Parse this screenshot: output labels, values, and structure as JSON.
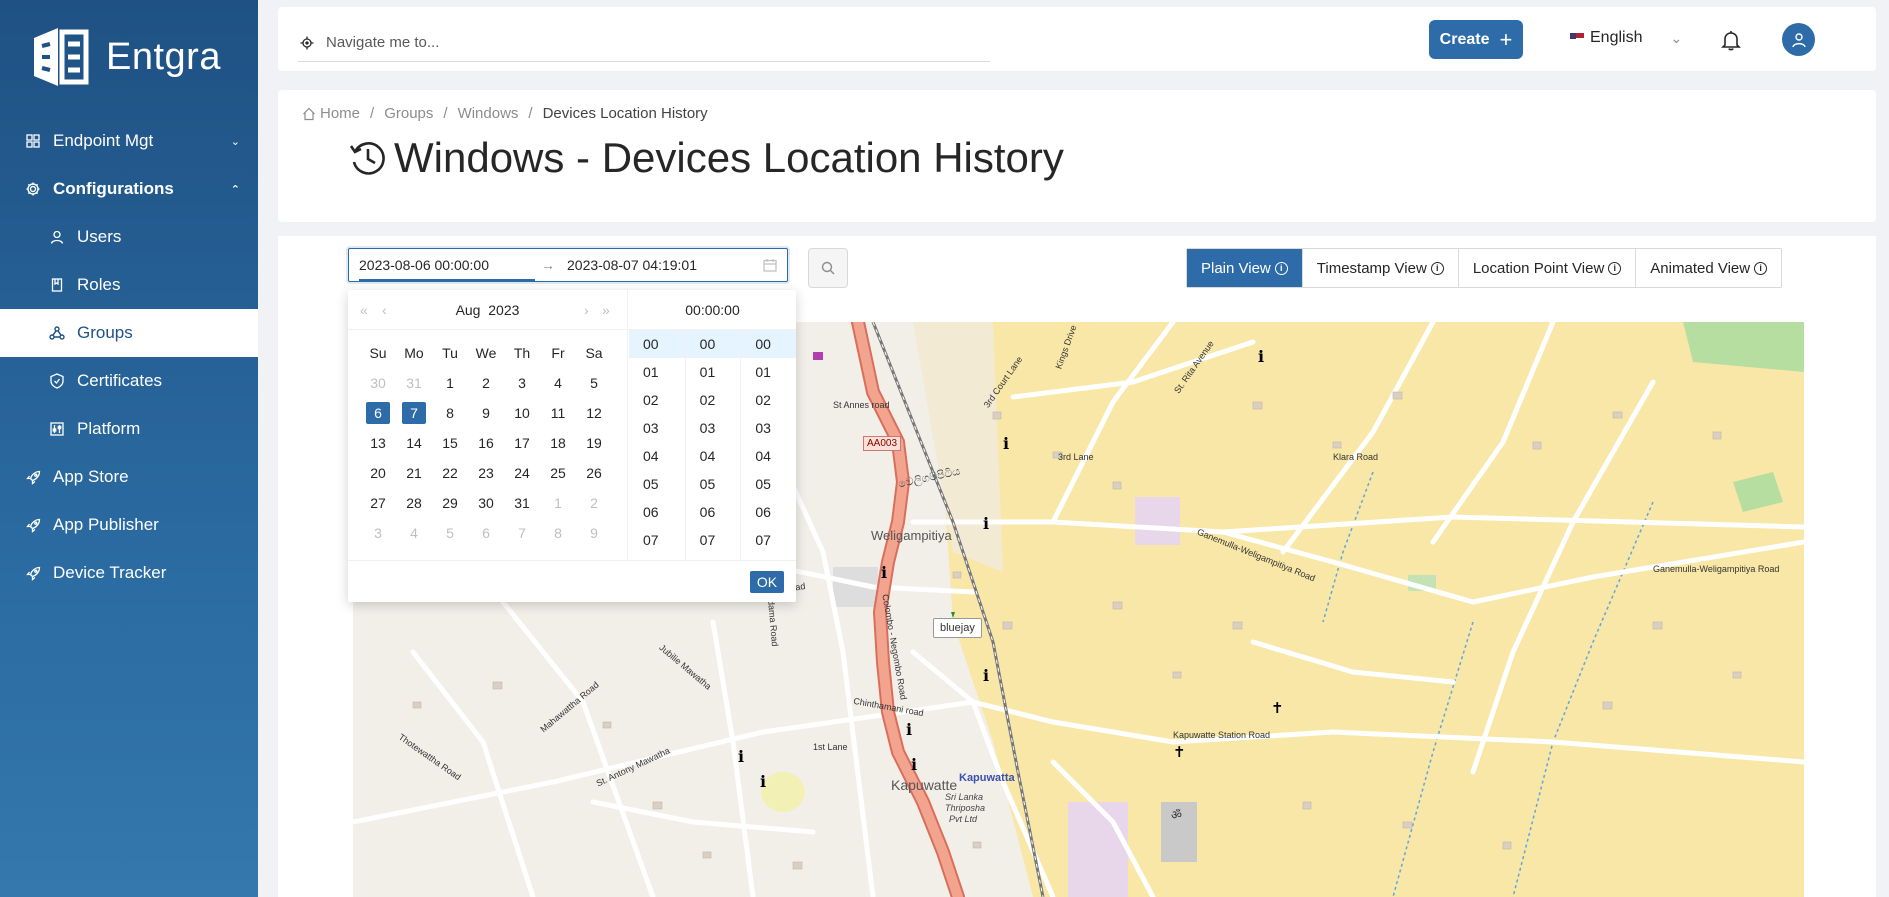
{
  "brand": {
    "name": "Entgra"
  },
  "sidebar": {
    "items": [
      {
        "label": "Endpoint Mgt",
        "icon": "grid-icon",
        "caret": "down"
      },
      {
        "label": "Configurations",
        "icon": "gear-icon",
        "caret": "up"
      },
      {
        "label": "Users",
        "icon": "user-icon"
      },
      {
        "label": "Roles",
        "icon": "book-icon"
      },
      {
        "label": "Groups",
        "icon": "group-icon"
      },
      {
        "label": "Certificates",
        "icon": "shield-icon"
      },
      {
        "label": "Platform",
        "icon": "sliders-icon"
      },
      {
        "label": "App Store",
        "icon": "rocket-icon"
      },
      {
        "label": "App Publisher",
        "icon": "rocket-icon"
      },
      {
        "label": "Device Tracker",
        "icon": "rocket-icon"
      }
    ]
  },
  "header": {
    "search_placeholder": "Navigate me to...",
    "create_label": "Create",
    "language": "English"
  },
  "breadcrumb": {
    "home": "Home",
    "groups": "Groups",
    "windows": "Windows",
    "current": "Devices Location History"
  },
  "page_title": "Windows - Devices Location History",
  "range": {
    "start": "2023-08-06 00:00:00",
    "end": "2023-08-07 04:19:01"
  },
  "view_tabs": [
    "Plain View",
    "Timestamp View",
    "Location Point View",
    "Animated View"
  ],
  "calendar": {
    "month": "Aug",
    "year": "2023",
    "days_of_week": [
      "Su",
      "Mo",
      "Tu",
      "We",
      "Th",
      "Fr",
      "Sa"
    ],
    "weeks": [
      [
        "30",
        "31",
        "1",
        "2",
        "3",
        "4",
        "5"
      ],
      [
        "6",
        "7",
        "8",
        "9",
        "10",
        "11",
        "12"
      ],
      [
        "13",
        "14",
        "15",
        "16",
        "17",
        "18",
        "19"
      ],
      [
        "20",
        "21",
        "22",
        "23",
        "24",
        "25",
        "26"
      ],
      [
        "27",
        "28",
        "29",
        "30",
        "31",
        "1",
        "2"
      ],
      [
        "3",
        "4",
        "5",
        "6",
        "7",
        "8",
        "9"
      ]
    ],
    "selected": [
      "6",
      "7"
    ]
  },
  "time_panel": {
    "header": "00:00:00",
    "hours": [
      "00",
      "01",
      "02",
      "03",
      "04",
      "05",
      "06",
      "07"
    ],
    "minutes": [
      "00",
      "01",
      "02",
      "03",
      "04",
      "05",
      "06",
      "07"
    ],
    "seconds": [
      "00",
      "01",
      "02",
      "03",
      "04",
      "05",
      "06",
      "07"
    ]
  },
  "ok_label": "OK",
  "map": {
    "labels": {
      "weligampitiya": "Weligampitiya",
      "kapuwatte": "Kapuwatte",
      "kapuwatta": "Kapuwatta",
      "sri_lanka": "Sri Lanka",
      "thriposha": "Thriposha",
      "pvt": "Pvt Ltd",
      "aa003": "AA003",
      "bluejay": "bluejay",
      "st_annes": "St Annes road",
      "cemetery": "cemetery road",
      "colombo": "Colombo - Negombo Road",
      "klara": "Klara Road",
      "ganemulla": "Ganemulla-Weligampitiya Road",
      "ganemulla2": "Ganemulla-Weligampitiya Road",
      "kapuwatte_station": "Kapuwatte Station Road",
      "chinthamani": "Chinthamani road",
      "jubilee": "Jubilie Mawatha",
      "mahawatha": "Mahawattha Road",
      "st_antony": "St. Antony Mawatha",
      "thotewattha": "Thotewattha Road",
      "first_lane": "1st Lane",
      "third_lane": "3rd Lane",
      "third_court": "3rd Court Lane",
      "kings_drive": "Kings Drive",
      "st_rita": "St. Rita Avenue",
      "madama": "Madama Road",
      "sinhala": "වෙලිගම්පිටිය",
      "om": "ॐ"
    }
  }
}
